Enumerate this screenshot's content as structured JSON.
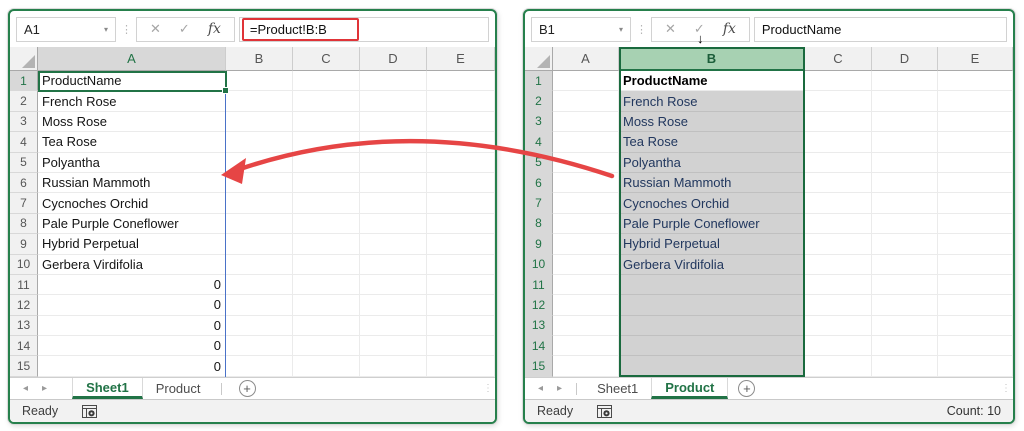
{
  "colors": {
    "excel_green": "#217346",
    "window_border_green": "#26804c",
    "formula_highlight_red": "#e03438",
    "arrow_red": "#e64545",
    "spill_border_blue": "#4a72c8",
    "selected_column_fill": "#d2d2d2",
    "selected_column_header_fill": "#a7d1b2"
  },
  "icons": {
    "dropdown": "▾",
    "dots": "⋮",
    "cancel": "✕",
    "enter": "✓",
    "fx": "fx",
    "nav_left": "◂",
    "nav_right": "▸",
    "plus": "+",
    "down_arrow": "↓"
  },
  "windows": [
    {
      "name_box": "A1",
      "formula": "=Product!B:B",
      "formula_boxed": true,
      "columns": [
        "A",
        "B",
        "C",
        "D",
        "E"
      ],
      "rows": [
        "1",
        "2",
        "3",
        "4",
        "5",
        "6",
        "7",
        "8",
        "9",
        "10",
        "11",
        "12",
        "13",
        "14",
        "15"
      ],
      "data_column_index": 0,
      "values": [
        "ProductName",
        "French Rose",
        "Moss Rose",
        "Tea Rose",
        "Polyantha",
        "Russian Mammoth",
        "Cycnoches Orchid",
        "Pale Purple Coneflower",
        "Hybrid Perpetual",
        "Gerbera Virdifolia"
      ],
      "tail_values": [
        "0",
        "0",
        "0",
        "0",
        "0"
      ],
      "selection": {
        "mode": "cell",
        "cell": "A1"
      },
      "tabs": [
        {
          "label": "Sheet1",
          "active": true
        },
        {
          "label": "Product",
          "active": false
        }
      ],
      "status": "Ready",
      "count": ""
    },
    {
      "name_box": "B1",
      "formula": "ProductName",
      "formula_boxed": false,
      "columns": [
        "A",
        "B",
        "C",
        "D",
        "E"
      ],
      "rows": [
        "1",
        "2",
        "3",
        "4",
        "5",
        "6",
        "7",
        "8",
        "9",
        "10",
        "11",
        "12",
        "13",
        "14",
        "15"
      ],
      "data_column_index": 1,
      "values": [
        "ProductName",
        "French Rose",
        "Moss Rose",
        "Tea Rose",
        "Polyantha",
        "Russian Mammoth",
        "Cycnoches Orchid",
        "Pale Purple Coneflower",
        "Hybrid Perpetual",
        "Gerbera Virdifolia"
      ],
      "tail_values": [],
      "selection": {
        "mode": "column",
        "column": "B"
      },
      "tabs": [
        {
          "label": "Sheet1",
          "active": false
        },
        {
          "label": "Product",
          "active": true
        }
      ],
      "status": "Ready",
      "count": "Count: 10"
    }
  ]
}
